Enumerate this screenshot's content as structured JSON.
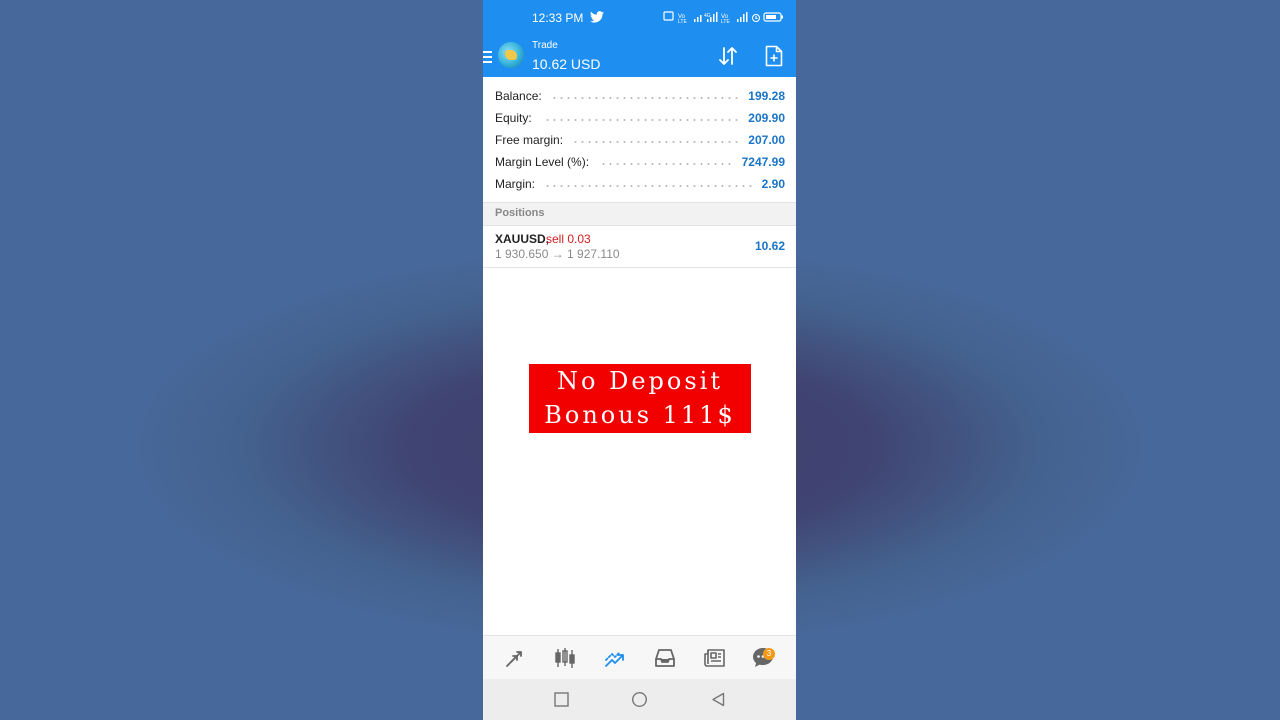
{
  "status_bar": {
    "time": "12:33 PM",
    "icons": [
      "twitter-icon",
      "cast-icon",
      "volte-icon",
      "signal-icon",
      "volte-icon",
      "signal-icon",
      "alarm-icon",
      "battery-icon"
    ]
  },
  "app_header": {
    "title": "Trade",
    "balance": "10.62 USD",
    "actions": [
      "sort-icon",
      "new-order-icon"
    ]
  },
  "account": {
    "rows": [
      {
        "label": "Balance:",
        "value": "199.28"
      },
      {
        "label": "Equity:",
        "value": "209.90"
      },
      {
        "label": "Free margin:",
        "value": "207.00"
      },
      {
        "label": "Margin Level (%):",
        "value": "7247.99"
      },
      {
        "label": "Margin:",
        "value": "2.90"
      }
    ]
  },
  "positions": {
    "header": "Positions",
    "items": [
      {
        "symbol": "XAUUSD,",
        "side": "sell 0.03",
        "prices": "1 930.650 → 1 927.110",
        "profit": "10.62"
      }
    ]
  },
  "banner": {
    "line1": "No Deposit",
    "line2": "Bonous 111$",
    "color": "#f20000"
  },
  "bottom_nav": {
    "items": [
      "quotes-icon",
      "chart-icon",
      "trade-icon",
      "history-icon",
      "news-icon",
      "chat-icon"
    ],
    "active": "trade-icon",
    "chat_badge": "3"
  },
  "system_nav": [
    "recents-icon",
    "home-icon",
    "back-icon"
  ],
  "colors": {
    "primary": "#1e8ff0",
    "value_blue": "#1a74c8",
    "sell_red": "#d32020"
  }
}
